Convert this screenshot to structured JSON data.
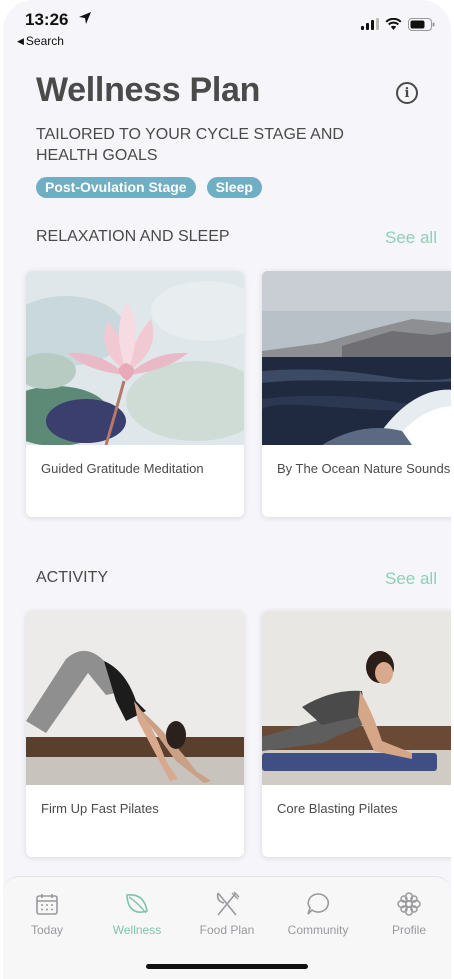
{
  "status_bar": {
    "time": "13:26",
    "back_label": "Search"
  },
  "header": {
    "title": "Wellness Plan",
    "info_glyph": "i",
    "subtitle": "TAILORED TO YOUR CYCLE STAGE AND HEALTH GOALS",
    "tags": [
      "Post-Ovulation Stage",
      "Sleep"
    ]
  },
  "sections": [
    {
      "title": "RELAXATION AND SLEEP",
      "see_all": "See all",
      "cards": [
        {
          "label": "Guided Gratitude Meditation",
          "image": "lotus-flower"
        },
        {
          "label": "By The Ocean Nature Sounds",
          "image": "ocean-waves"
        }
      ]
    },
    {
      "title": "ACTIVITY",
      "see_all": "See all",
      "cards": [
        {
          "label": "Firm Up Fast Pilates",
          "image": "downward-dog-pose"
        },
        {
          "label": "Core Blasting Pilates",
          "image": "plank-pose"
        }
      ]
    }
  ],
  "tabbar": {
    "tabs": [
      {
        "label": "Today",
        "icon": "calendar-icon",
        "active": false
      },
      {
        "label": "Wellness",
        "icon": "leaf-icon",
        "active": true
      },
      {
        "label": "Food Plan",
        "icon": "fork-knife-icon",
        "active": false
      },
      {
        "label": "Community",
        "icon": "chat-bubble-icon",
        "active": false
      },
      {
        "label": "Profile",
        "icon": "flower-icon",
        "active": false
      }
    ]
  },
  "colors": {
    "accent": "#7dc4ab",
    "tag": "#6faec3",
    "text": "#4a4a4a",
    "background": "#f6f5f9"
  }
}
